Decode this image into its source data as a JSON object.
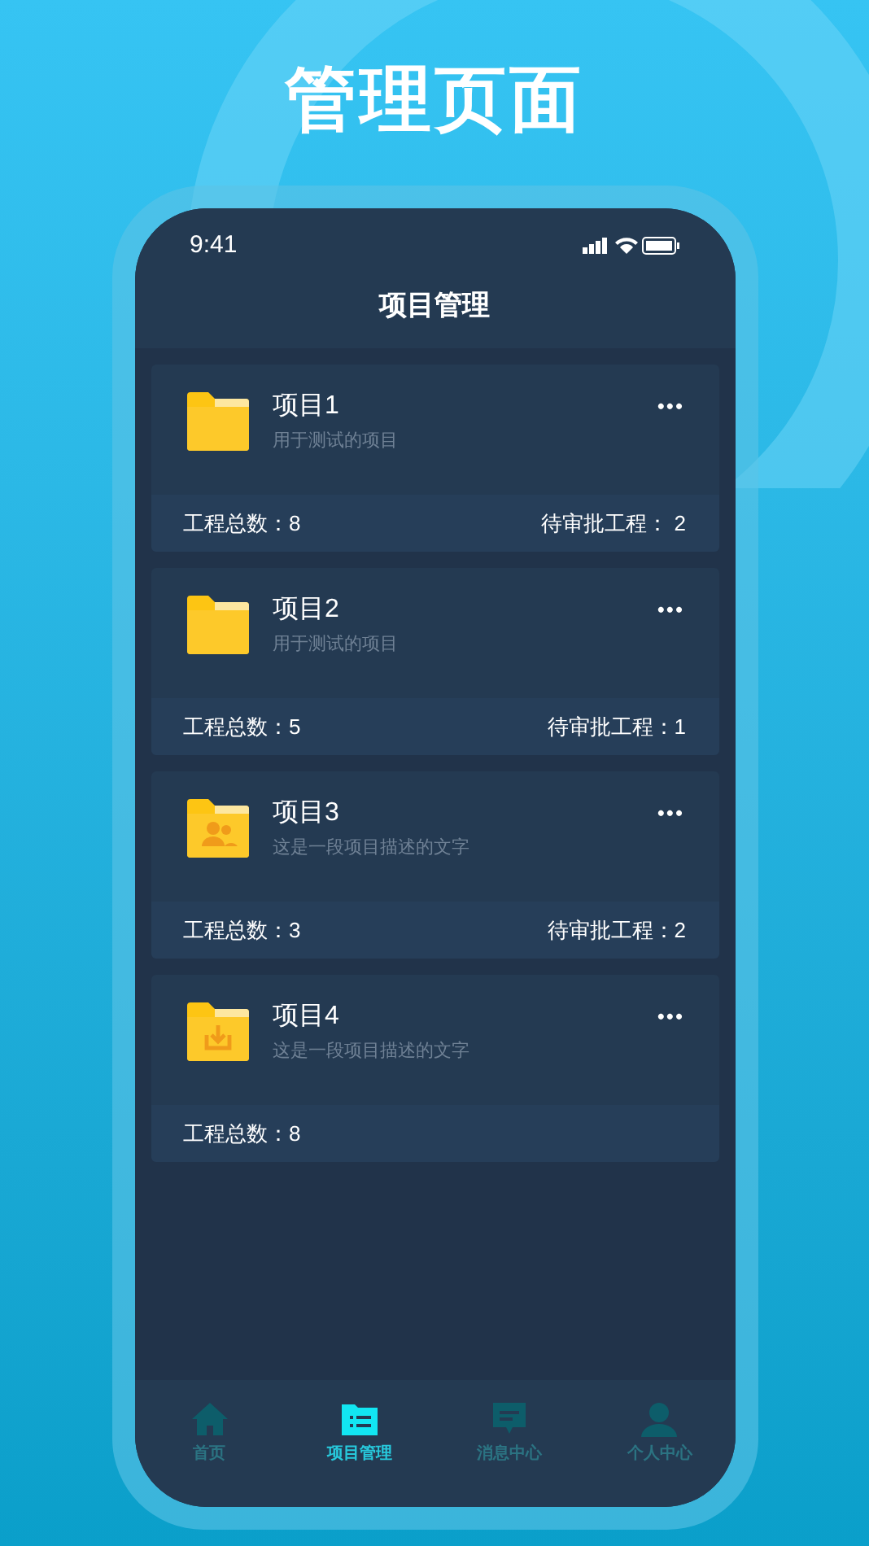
{
  "headline": "管理页面",
  "status_bar": {
    "time": "9:41"
  },
  "header": {
    "title": "项目管理"
  },
  "projects": [
    {
      "name": "项目1",
      "description": "用于测试的项目",
      "kind": "plain",
      "total": "工程总数：8",
      "pending": "待审批工程： 2"
    },
    {
      "name": "项目2",
      "description": "用于测试的项目",
      "kind": "plain",
      "total": "工程总数：5",
      "pending": "待审批工程：1"
    },
    {
      "name": "项目3",
      "description": "这是一段项目描述的文字",
      "kind": "people",
      "total": "工程总数：3",
      "pending": "待审批工程：2"
    },
    {
      "name": "项目4",
      "description": "这是一段项目描述的文字",
      "kind": "download",
      "total": "工程总数：8"
    }
  ],
  "more_label": "•••",
  "tabs": [
    {
      "label": "首页",
      "kind": "home",
      "selected": false
    },
    {
      "label": "项目管理",
      "kind": "list",
      "selected": true
    },
    {
      "label": "消息中心",
      "kind": "message",
      "selected": false
    },
    {
      "label": "个人中心",
      "kind": "person",
      "selected": false
    }
  ]
}
